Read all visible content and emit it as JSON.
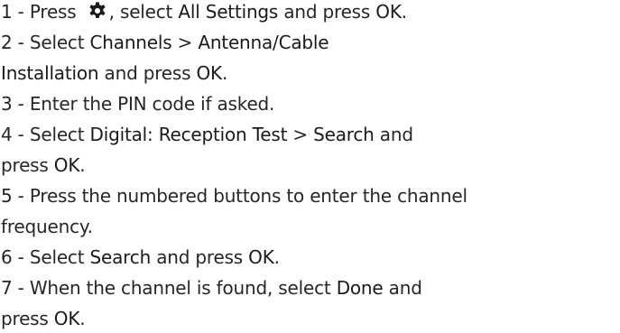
{
  "lines": [
    {
      "num": "1 - ",
      "segments": [
        {
          "t": "Press ",
          "b": false
        },
        {
          "icon": "gear-icon"
        },
        {
          "t": ", select ",
          "b": false
        },
        {
          "t": "All Settings",
          "b": true
        },
        {
          "t": " and press ",
          "b": false
        },
        {
          "t": "OK",
          "b": true
        },
        {
          "t": ".",
          "b": false
        }
      ]
    },
    {
      "num": "2 - ",
      "segments": [
        {
          "t": "Select ",
          "b": false
        },
        {
          "t": "Channels",
          "b": true
        },
        {
          "t": " > ",
          "b": false
        },
        {
          "t": "Antenna/Cable",
          "b": true
        }
      ]
    },
    {
      "num": "",
      "segments": [
        {
          "t": "Installation",
          "b": true
        },
        {
          "t": " and press ",
          "b": false
        },
        {
          "t": "OK",
          "b": true
        },
        {
          "t": ".",
          "b": false
        }
      ]
    },
    {
      "num": "3 - ",
      "segments": [
        {
          "t": "Enter the PIN code if asked.",
          "b": false
        }
      ]
    },
    {
      "num": "4 - ",
      "segments": [
        {
          "t": "Select ",
          "b": false
        },
        {
          "t": "Digital: Reception Test",
          "b": true
        },
        {
          "t": " > ",
          "b": false
        },
        {
          "t": "Search",
          "b": true
        },
        {
          "t": " and",
          "b": false
        }
      ]
    },
    {
      "num": "",
      "segments": [
        {
          "t": "press ",
          "b": false
        },
        {
          "t": "OK",
          "b": true
        },
        {
          "t": ".",
          "b": false
        }
      ]
    },
    {
      "num": "5 - ",
      "segments": [
        {
          "t": "Press the numbered buttons to enter the channel",
          "b": false
        }
      ]
    },
    {
      "num": "",
      "segments": [
        {
          "t": "frequency.",
          "b": false
        }
      ]
    },
    {
      "num": "6 - ",
      "segments": [
        {
          "t": "Select ",
          "b": false
        },
        {
          "t": "Search",
          "b": true
        },
        {
          "t": " and press ",
          "b": false
        },
        {
          "t": "OK",
          "b": true
        },
        {
          "t": ".",
          "b": false
        }
      ]
    },
    {
      "num": "7 - ",
      "segments": [
        {
          "t": "When the channel is found, select ",
          "b": false
        },
        {
          "t": "Done",
          "b": true
        },
        {
          "t": " and",
          "b": false
        }
      ]
    },
    {
      "num": "",
      "segments": [
        {
          "t": "press ",
          "b": false
        },
        {
          "t": "OK",
          "b": true
        },
        {
          "t": ".",
          "b": false
        }
      ]
    }
  ]
}
